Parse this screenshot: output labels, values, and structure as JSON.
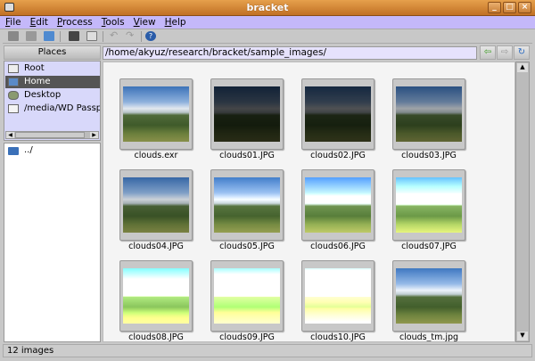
{
  "window": {
    "title": "bracket"
  },
  "menu": [
    "File",
    "Edit",
    "Process",
    "Tools",
    "View",
    "Help"
  ],
  "places": {
    "header": "Places",
    "items": [
      {
        "label": "Root"
      },
      {
        "label": "Home",
        "selected": true
      },
      {
        "label": "Desktop"
      },
      {
        "label": "/media/WD Passpo"
      }
    ]
  },
  "dirs": [
    "../"
  ],
  "path": "/home/akyuz/research/bracket/sample_images/",
  "images": [
    "clouds.exr",
    "clouds01.JPG",
    "clouds02.JPG",
    "clouds03.JPG",
    "clouds04.JPG",
    "clouds05.JPG",
    "clouds06.JPG",
    "clouds07.JPG",
    "clouds08.JPG",
    "clouds09.JPG",
    "clouds10.JPG",
    "clouds_tm.jpg"
  ],
  "status": "12 images"
}
